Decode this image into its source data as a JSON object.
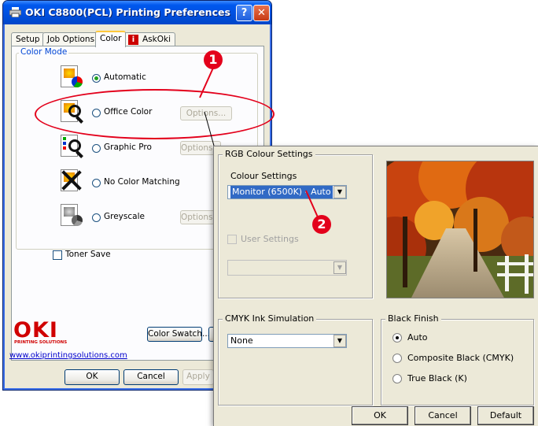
{
  "main_window": {
    "title": "OKI C8800(PCL) Printing Preferences",
    "help_button": "?",
    "close_button": "✕",
    "tabs": [
      "Setup",
      "Job Options",
      "Color",
      "AskOki"
    ],
    "active_tab": "Color",
    "color_mode_title": "Color Mode",
    "modes": [
      {
        "label": "Automatic",
        "selected": true,
        "has_options": false
      },
      {
        "label": "Office Color",
        "selected": false,
        "has_options": true,
        "options_label": "Options..."
      },
      {
        "label": "Graphic Pro",
        "selected": false,
        "has_options": true,
        "options_label": "Options..."
      },
      {
        "label": "No Color Matching",
        "selected": false,
        "has_options": false
      },
      {
        "label": "Greyscale",
        "selected": false,
        "has_options": true,
        "options_label": "Options..."
      }
    ],
    "toner_save_label": "Toner Save",
    "logo_text": "OKI",
    "logo_tagline": "PRINTING SOLUTIONS",
    "website": "www.okiprintingsolutions.com",
    "color_swatch_label": "Color Swatch...",
    "ok_label": "OK",
    "cancel_label": "Cancel",
    "apply_label": "Apply"
  },
  "callouts": {
    "badge1": "1",
    "badge2": "2",
    "color": "#e3001b"
  },
  "rgb_dialog": {
    "rgb_group_title": "RGB Colour Settings",
    "colour_settings_label": "Colour Settings",
    "colour_settings_value": "Monitor (6500K) - Auto",
    "user_settings_label": "User Settings",
    "cmyk_group_title": "CMYK Ink Simulation",
    "cmyk_value": "None",
    "black_finish_title": "Black Finish",
    "black_finish_options": [
      {
        "label": "Auto",
        "selected": true
      },
      {
        "label": "Composite Black (CMYK)",
        "selected": false
      },
      {
        "label": "True Black (K)",
        "selected": false
      }
    ],
    "ok_label": "OK",
    "cancel_label": "Cancel",
    "default_label": "Default"
  },
  "colors": {
    "xp_title_blue": "#0054e3",
    "selection": "#316ac5",
    "oki_red": "#d00000"
  }
}
